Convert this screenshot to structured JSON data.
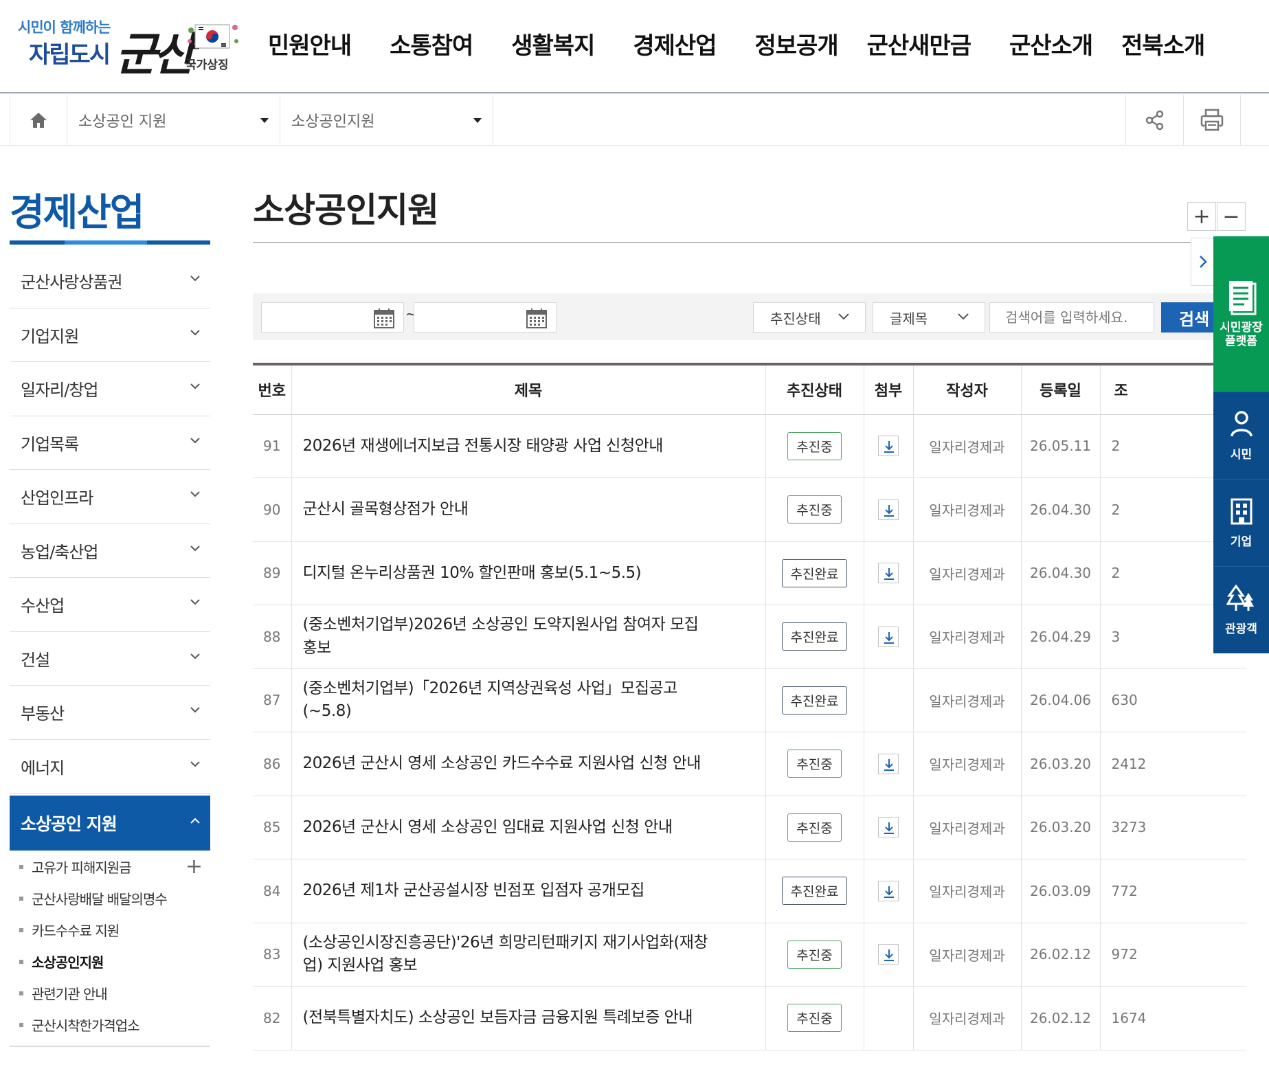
{
  "header": {
    "logo": {
      "slogan": "시민이 함께하는",
      "city": "자립도시",
      "brand": "군산",
      "national_symbol": "국가상징"
    },
    "nav": [
      "민원안내",
      "소통참여",
      "생활복지",
      "경제산업",
      "정보공개",
      "군산새만금",
      "군산소개",
      "전북소개"
    ]
  },
  "breadcrumb": {
    "home_icon": "home-icon",
    "level1": "소상공인 지원",
    "level2": "소상공인지원",
    "share_icon": "share-icon",
    "print_icon": "print-icon"
  },
  "sidebar": {
    "title": "경제산업",
    "items": [
      "군산사랑상품권",
      "기업지원",
      "일자리/창업",
      "기업목록",
      "산업인프라",
      "농업/축산업",
      "수산업",
      "건설",
      "부동산",
      "에너지"
    ],
    "active": "소상공인 지원",
    "sub_items": [
      "고유가 피해지원금",
      "군산사랑배달 배달의명수",
      "카드수수료 지원",
      "소상공인지원",
      "관련기관 안내",
      "군산시착한가격업소"
    ],
    "current_sub": "소상공인지원"
  },
  "main": {
    "title": "소상공인지원",
    "zoom_in": "+",
    "zoom_out": "−",
    "search": {
      "tilde": "~",
      "status_select": "추진상태",
      "field_select": "글제목",
      "keyword_placeholder": "검색어를 입력하세요.",
      "button": "검색"
    },
    "table": {
      "headers": [
        "번호",
        "제목",
        "추진상태",
        "첨부",
        "작성자",
        "등록일",
        "조"
      ],
      "rows": [
        {
          "no": "91",
          "title": "2026년 재생에너지보급 전통시장 태양광 사업 신청안내",
          "status": "추진중",
          "attach": true,
          "author": "일자리경제과",
          "date": "26.05.11",
          "views": "2"
        },
        {
          "no": "90",
          "title": "군산시 골목형상점가 안내",
          "status": "추진중",
          "attach": true,
          "author": "일자리경제과",
          "date": "26.04.30",
          "views": "2"
        },
        {
          "no": "89",
          "title": "디지털 온누리상품권 10% 할인판매 홍보(5.1~5.5)",
          "status": "추진완료",
          "attach": true,
          "author": "일자리경제과",
          "date": "26.04.30",
          "views": "2"
        },
        {
          "no": "88",
          "title": "(중소벤처기업부)2026년 소상공인 도약지원사업 참여자 모집홍보",
          "status": "추진완료",
          "attach": true,
          "author": "일자리경제과",
          "date": "26.04.29",
          "views": "3"
        },
        {
          "no": "87",
          "title": "(중소벤처기업부)「2026년 지역상권육성 사업」모집공고 (~5.8)",
          "status": "추진완료",
          "attach": false,
          "author": "일자리경제과",
          "date": "26.04.06",
          "views": "630"
        },
        {
          "no": "86",
          "title": "2026년 군산시 영세 소상공인 카드수수료 지원사업 신청 안내",
          "status": "추진중",
          "attach": true,
          "author": "일자리경제과",
          "date": "26.03.20",
          "views": "2412"
        },
        {
          "no": "85",
          "title": "2026년 군산시 영세 소상공인 임대료 지원사업 신청 안내",
          "status": "추진중",
          "attach": true,
          "author": "일자리경제과",
          "date": "26.03.20",
          "views": "3273"
        },
        {
          "no": "84",
          "title": "2026년 제1차 군산공설시장 빈점포 입점자 공개모집",
          "status": "추진완료",
          "attach": true,
          "author": "일자리경제과",
          "date": "26.03.09",
          "views": "772"
        },
        {
          "no": "83",
          "title": "(소상공인시장진흥공단)'26년 희망리턴패키지 재기사업화(재창업) 지원사업 홍보",
          "status": "추진중",
          "attach": true,
          "author": "일자리경제과",
          "date": "26.02.12",
          "views": "972"
        },
        {
          "no": "82",
          "title": "(전북특별자치도) 소상공인 보듬자금 금융지원 특례보증 안내",
          "status": "추진중",
          "attach": false,
          "author": "일자리경제과",
          "date": "26.02.12",
          "views": "1674"
        }
      ]
    }
  },
  "quick_menu": {
    "platform": "시민광장 플랫폼",
    "items": [
      {
        "label": "시민",
        "icon": "person-icon"
      },
      {
        "label": "기업",
        "icon": "building-icon"
      },
      {
        "label": "관광객",
        "icon": "trees-icon"
      }
    ]
  },
  "colors": {
    "primary": "#0e5aa7",
    "search_button": "#1e64b4",
    "quick_green": "#079a55",
    "quick_blue": "#0c4b8a",
    "badge_ongoing": "#4ca35f",
    "badge_done": "#445468"
  }
}
